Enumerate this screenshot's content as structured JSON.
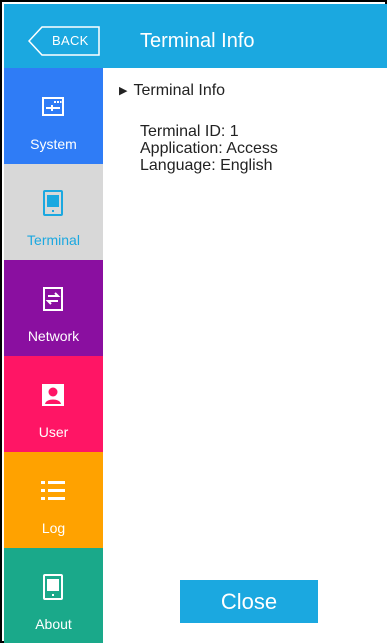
{
  "header": {
    "back_label": "BACK",
    "title": "Terminal Info"
  },
  "sidebar": {
    "items": [
      {
        "label": "System",
        "icon": "system-settings-icon",
        "color": "#2f7cf6"
      },
      {
        "label": "Terminal",
        "icon": "terminal-device-icon",
        "color": "#d8d8d8",
        "active": true,
        "active_color": "#1ba8e0"
      },
      {
        "label": "Network",
        "icon": "network-icon",
        "color": "#8a0fa0"
      },
      {
        "label": "User",
        "icon": "user-icon",
        "color": "#ff1565"
      },
      {
        "label": "Log",
        "icon": "log-list-icon",
        "color": "#ffa200"
      },
      {
        "label": "About",
        "icon": "about-device-icon",
        "color": "#1aa98a"
      }
    ]
  },
  "content": {
    "section_title": "Terminal Info",
    "lines": [
      "Terminal ID: 1",
      "Application: Access",
      "Language: English"
    ],
    "close_label": "Close"
  },
  "colors": {
    "accent": "#1ba8e0",
    "sidebar_bg": "#d8d8d8"
  }
}
